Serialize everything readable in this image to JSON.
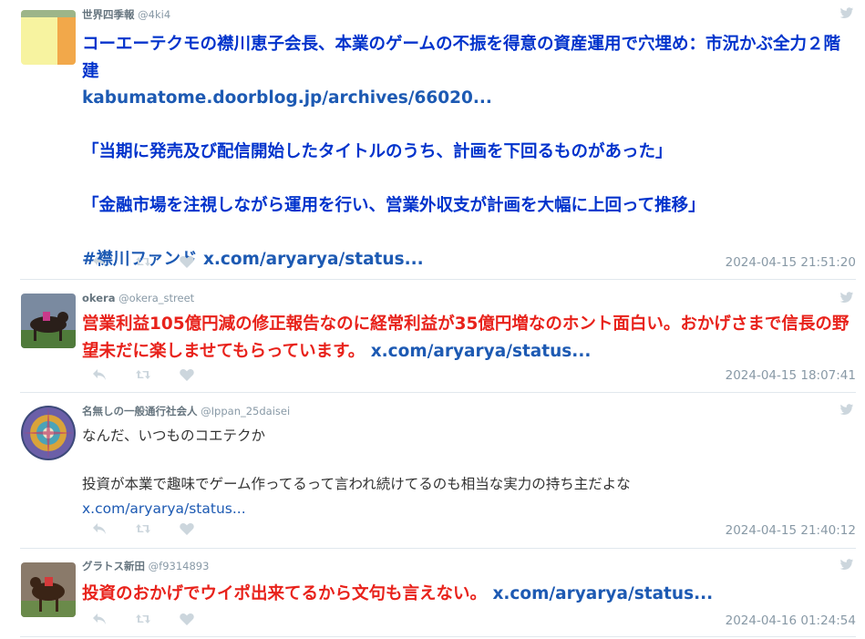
{
  "tweets": [
    {
      "name": "世界四季報",
      "handle": "@4ki4",
      "lines": [
        "コーエーテクモの襟川恵子会長、本業のゲームの不振を得意の資産運用で穴埋め：市況かぶ全力２階建",
        "kabumatome.doorblog.jp/archives/66020...",
        "「当期に発売及び配信開始したタイトルのうち、計画を下回るものがあった」",
        "「金融市場を注視しながら運用を行い、営業外収支が計画を大幅に上回って推移」",
        "#襟川ファンド",
        "x.com/aryarya/status..."
      ],
      "time": "2024-04-15 21:51:20"
    },
    {
      "name": "okera",
      "handle": "@okera_street",
      "text": "営業利益105億円減の修正報告なのに経常利益が35億円増なのホント面白い。おかげさまで信長の野望未だに楽しませてもらっています。",
      "link": "x.com/aryarya/status...",
      "time": "2024-04-15 18:07:41"
    },
    {
      "name": "名無しの一般通行社会人",
      "handle": "@Ippan_25daisei",
      "line1": "なんだ、いつものコエテクか",
      "line2": "投資が本業で趣味でゲーム作ってるって言われ続けてるのも相当な実力の持ち主だよな",
      "link": "x.com/aryarya/status...",
      "time": "2024-04-15 21:40:12"
    },
    {
      "name": "グラトス新田",
      "handle": "@f9314893",
      "text": "投資のおかげでウイポ出来てるから文句も言えない。",
      "link": "x.com/aryarya/status...",
      "time": "2024-04-16 01:24:54"
    }
  ],
  "icons": [
    "reply-icon",
    "retweet-icon",
    "like-icon",
    "twitter-bird-icon"
  ],
  "colors": {
    "headline_blue": "#0033cc",
    "red_text": "#e8221b",
    "link": "#1d5ab3",
    "meta_gray": "#8899a6",
    "icon_gray": "#ccd6dd"
  }
}
